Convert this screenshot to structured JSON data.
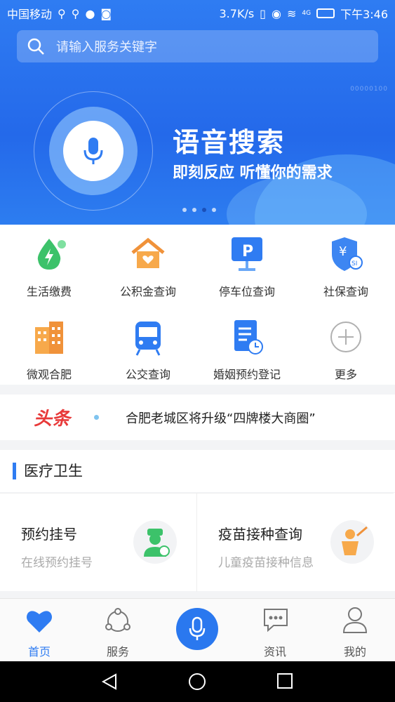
{
  "status": {
    "carrier": "中国移动",
    "speed": "3.7K/s",
    "network": "4G",
    "time": "下午3:46"
  },
  "search": {
    "placeholder": "请输入服务关键字"
  },
  "banner": {
    "title": "语音搜索",
    "subtitle": "即刻反应 听懂你的需求",
    "tiny": "00000100",
    "dots": 4,
    "active_dot": 2
  },
  "services": [
    {
      "label": "生活缴费",
      "icon": "water-drop-bolt-icon"
    },
    {
      "label": "公积金查询",
      "icon": "house-heart-icon"
    },
    {
      "label": "停车位查询",
      "icon": "parking-sign-icon"
    },
    {
      "label": "社保查询",
      "icon": "shield-yen-icon"
    },
    {
      "label": "微观合肥",
      "icon": "buildings-icon"
    },
    {
      "label": "公交查询",
      "icon": "bus-icon"
    },
    {
      "label": "婚姻预约登记",
      "icon": "document-clock-icon"
    },
    {
      "label": "更多",
      "icon": "plus-circle-icon"
    }
  ],
  "news": {
    "tag": "头条",
    "headline": "合肥老城区将升级“四牌楼大商圈”"
  },
  "section": {
    "title": "医疗卫生"
  },
  "cards": [
    {
      "title": "预约挂号",
      "subtitle": "在线预约挂号",
      "icon": "doctor-icon"
    },
    {
      "title": "疫苗接种查询",
      "subtitle": "儿童疫苗接种信息",
      "icon": "vaccine-child-icon"
    }
  ],
  "tabs": [
    {
      "label": "首页",
      "icon": "heart-icon",
      "active": true
    },
    {
      "label": "服务",
      "icon": "share-icon"
    },
    {
      "label": "",
      "icon": "mic-icon"
    },
    {
      "label": "资讯",
      "icon": "message-icon"
    },
    {
      "label": "我的",
      "icon": "user-icon"
    }
  ],
  "colors": {
    "primary": "#2f7cf2",
    "headline_red": "#e83a3a"
  }
}
